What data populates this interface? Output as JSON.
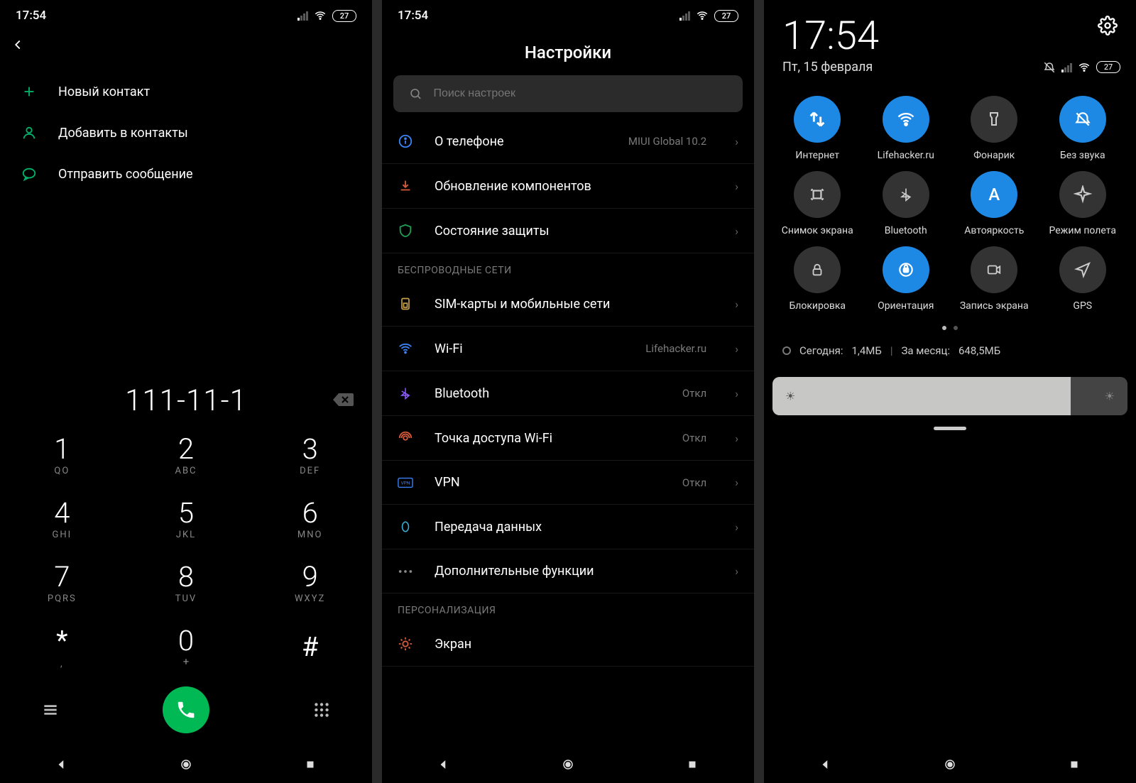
{
  "status": {
    "time": "17:54",
    "battery": "27"
  },
  "screen1": {
    "actions": {
      "new_contact": "Новый контакт",
      "add_contact": "Добавить в контакты",
      "send_message": "Отправить сообщение"
    },
    "number": "111-11-1",
    "keys": {
      "k1": {
        "d": "1",
        "l": "QO"
      },
      "k2": {
        "d": "2",
        "l": "ABC"
      },
      "k3": {
        "d": "3",
        "l": "DEF"
      },
      "k4": {
        "d": "4",
        "l": "GHI"
      },
      "k5": {
        "d": "5",
        "l": "JKL"
      },
      "k6": {
        "d": "6",
        "l": "MNO"
      },
      "k7": {
        "d": "7",
        "l": "PQRS"
      },
      "k8": {
        "d": "8",
        "l": "TUV"
      },
      "k9": {
        "d": "9",
        "l": "WXYZ"
      },
      "kstar": {
        "d": "*",
        "l": ","
      },
      "k0": {
        "d": "0",
        "l": "+"
      },
      "khash": {
        "d": "#",
        "l": ""
      }
    }
  },
  "screen2": {
    "title": "Настройки",
    "search_placeholder": "Поиск настроек",
    "items": {
      "about": {
        "label": "О телефоне",
        "value": "MIUI Global 10.2"
      },
      "update": {
        "label": "Обновление компонентов",
        "value": ""
      },
      "security": {
        "label": "Состояние защиты",
        "value": ""
      }
    },
    "section_wireless": "БЕСПРОВОДНЫЕ СЕТИ",
    "wireless": {
      "sim": {
        "label": "SIM-карты и мобильные сети",
        "value": ""
      },
      "wifi": {
        "label": "Wi-Fi",
        "value": "Lifehacker.ru"
      },
      "bt": {
        "label": "Bluetooth",
        "value": "Откл"
      },
      "hotspot": {
        "label": "Точка доступа Wi-Fi",
        "value": "Откл"
      },
      "vpn": {
        "label": "VPN",
        "value": "Откл"
      },
      "data": {
        "label": "Передача данных",
        "value": ""
      },
      "more": {
        "label": "Дополнительные функции",
        "value": ""
      }
    },
    "section_personal": "ПЕРСОНАЛИЗАЦИЯ",
    "personal": {
      "display": {
        "label": "Экран",
        "value": ""
      }
    }
  },
  "screen3": {
    "time": "17:54",
    "date": "Пт, 15 февраля",
    "tiles": {
      "t0": {
        "label": "Интернет",
        "active": true
      },
      "t1": {
        "label": "Lifehacker.ru",
        "active": true
      },
      "t2": {
        "label": "Фонарик",
        "active": false
      },
      "t3": {
        "label": "Без звука",
        "active": true
      },
      "t4": {
        "label": "Снимок экрана",
        "active": false
      },
      "t5": {
        "label": "Bluetooth",
        "active": false
      },
      "t6": {
        "label": "Автояркость",
        "active": true
      },
      "t7": {
        "label": "Режим полета",
        "active": false
      },
      "t8": {
        "label": "Блокировка",
        "active": false
      },
      "t9": {
        "label": "Ориентация",
        "active": true
      },
      "t10": {
        "label": "Запись экрана",
        "active": false
      },
      "t11": {
        "label": "GPS",
        "active": false
      }
    },
    "usage": {
      "today_label": "Сегодня:",
      "today_value": "1,4МБ",
      "month_label": "За месяц:",
      "month_value": "648,5МБ"
    }
  }
}
